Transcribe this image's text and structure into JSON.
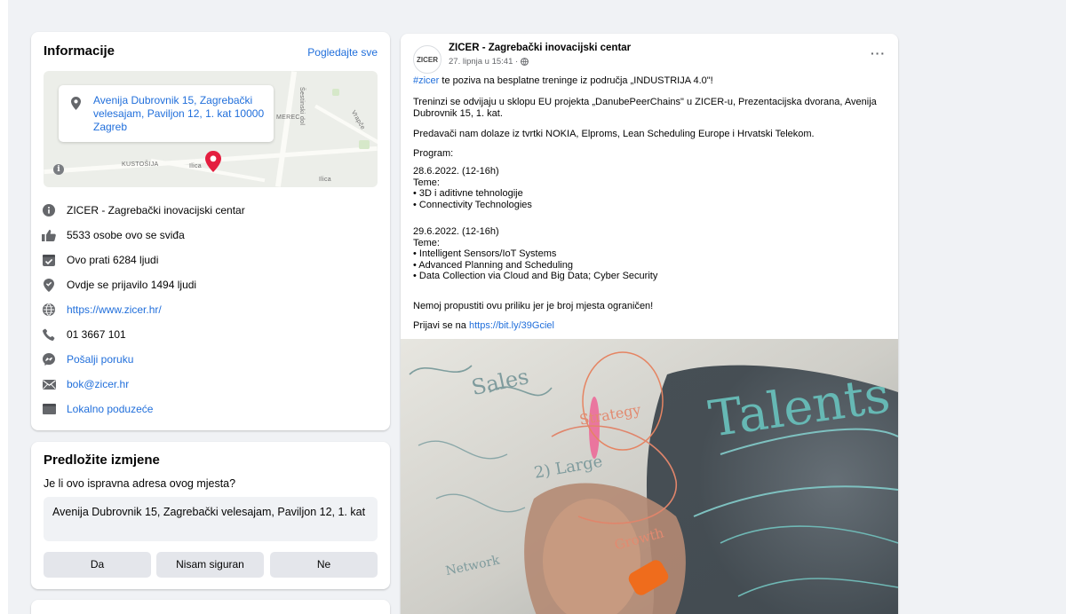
{
  "info": {
    "title": "Informacije",
    "see_all": "Pogledajte sve",
    "map": {
      "address": "Avenija Dubrovnik 15, Zagrebački velesajam, Paviljon 12, 1. kat 10000 Zagreb",
      "labels": [
        "KUSTOŠIJA",
        "MEREC",
        "Šestinski dol",
        "Vrapče",
        "Ilica",
        "Ilica"
      ]
    },
    "rows": [
      {
        "icon": "info-icon",
        "text": "ZICER - Zagrebački inovacijski centar",
        "link": false
      },
      {
        "icon": "thumbs-up-icon",
        "text": "5533 osobe ovo se sviđa",
        "link": false
      },
      {
        "icon": "follow-icon",
        "text": "Ovo prati 6284 ljudi",
        "link": false
      },
      {
        "icon": "location-icon",
        "text": "Ovdje se prijavilo 1494 ljudi",
        "link": false
      },
      {
        "icon": "globe-icon",
        "text": "https://www.zicer.hr/",
        "link": true
      },
      {
        "icon": "phone-icon",
        "text": "01 3667 101",
        "link": false
      },
      {
        "icon": "messenger-icon",
        "text": "Pošalji poruku",
        "link": true
      },
      {
        "icon": "email-icon",
        "text": "bok@zicer.hr",
        "link": true
      },
      {
        "icon": "category-icon",
        "text": "Lokalno poduzeće",
        "link": true
      }
    ]
  },
  "suggest": {
    "title": "Predložite izmjene",
    "question": "Je li ovo ispravna adresa ovog mjesta?",
    "address": "Avenija Dubrovnik 15, Zagrebački velesajam, Paviljon 12, 1. kat",
    "buttons": {
      "yes": "Da",
      "unsure": "Nisam siguran",
      "no": "Ne"
    }
  },
  "post": {
    "avatar_text": "ZICER",
    "author": "ZICER - Zagrebački inovacijski centar",
    "time": "27. lipnja u 15:41 ·",
    "more": "···",
    "hashtag": "#zicer",
    "intro_rest": " te poziva na besplatne treninge iz područja „INDUSTRIJA 4.0\"!",
    "p2": "Treninzi se odvijaju u sklopu EU projekta „DanubePeerChains\" u ZICER-u, Prezentacijska dvorana, Avenija Dubrovnik 15, 1. kat.",
    "p3": "Predavači nam dolaze iz tvrtki NOKIA, Elproms, Lean Scheduling Europe i Hrvatski Telekom.",
    "p4": "Program:",
    "day1": "28.6.2022. (12-16h)\nTeme:\n• 3D i aditivne tehnologije\n• Connectivity Technologies",
    "day2": "29.6.2022. (12-16h)\nTeme:\n• Intelligent Sensors/IoT Systems\n• Advanced Planning and Scheduling\n• Data Collection via Cloud and Big Data; Cyber Security",
    "p5": "Nemoj propustiti ovu priliku jer je broj mjesta ograničen!",
    "signup_prefix": "Prijavi se na ",
    "signup_link": "https://bit.ly/39Gciel",
    "image_words": [
      "Talents",
      "Sales",
      "Strategy",
      "2) Large",
      "Growth",
      "Network"
    ]
  }
}
